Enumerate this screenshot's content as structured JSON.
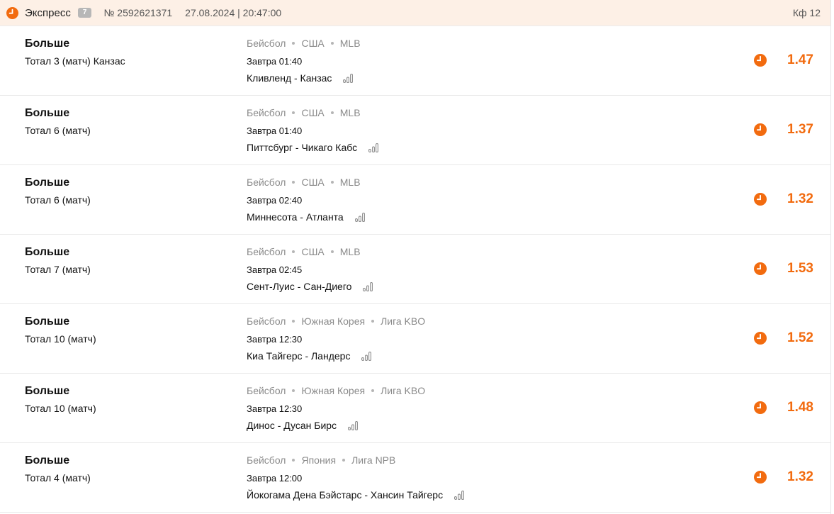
{
  "header": {
    "type": "Экспресс",
    "count": "7",
    "number": "№ 2592621371",
    "datetime": "27.08.2024 | 20:47:00",
    "kf": "Кф 12"
  },
  "colors": {
    "accent": "#f26b0f",
    "header_bg": "#fdf0e6",
    "muted": "#8a8a8a"
  },
  "icons": {
    "status": "clock-icon",
    "stats": "stats-bars-icon"
  },
  "bets": [
    {
      "title": "Больше",
      "market": "Тотал 3 (матч) Канзас",
      "sport": "Бейсбол",
      "country": "США",
      "league": "MLB",
      "time": "Завтра 01:40",
      "match": "Кливленд - Канзас",
      "odd": "1.47"
    },
    {
      "title": "Больше",
      "market": "Тотал 6 (матч)",
      "sport": "Бейсбол",
      "country": "США",
      "league": "MLB",
      "time": "Завтра 01:40",
      "match": "Питтсбург - Чикаго Кабс",
      "odd": "1.37"
    },
    {
      "title": "Больше",
      "market": "Тотал 6 (матч)",
      "sport": "Бейсбол",
      "country": "США",
      "league": "MLB",
      "time": "Завтра 02:40",
      "match": "Миннесота - Атланта",
      "odd": "1.32"
    },
    {
      "title": "Больше",
      "market": "Тотал 7 (матч)",
      "sport": "Бейсбол",
      "country": "США",
      "league": "MLB",
      "time": "Завтра 02:45",
      "match": "Сент-Луис - Сан-Диего",
      "odd": "1.53"
    },
    {
      "title": "Больше",
      "market": "Тотал 10 (матч)",
      "sport": "Бейсбол",
      "country": "Южная Корея",
      "league": "Лига KBO",
      "time": "Завтра 12:30",
      "match": "Киа Тайгерс - Ландерс",
      "odd": "1.52"
    },
    {
      "title": "Больше",
      "market": "Тотал 10 (матч)",
      "sport": "Бейсбол",
      "country": "Южная Корея",
      "league": "Лига KBO",
      "time": "Завтра 12:30",
      "match": "Динос - Дусан Бирс",
      "odd": "1.48"
    },
    {
      "title": "Больше",
      "market": "Тотал 4 (матч)",
      "sport": "Бейсбол",
      "country": "Япония",
      "league": "Лига NPB",
      "time": "Завтра 12:00",
      "match": "Йокогама Дена Бэйстарс - Хансин Тайгерс",
      "odd": "1.32"
    }
  ]
}
